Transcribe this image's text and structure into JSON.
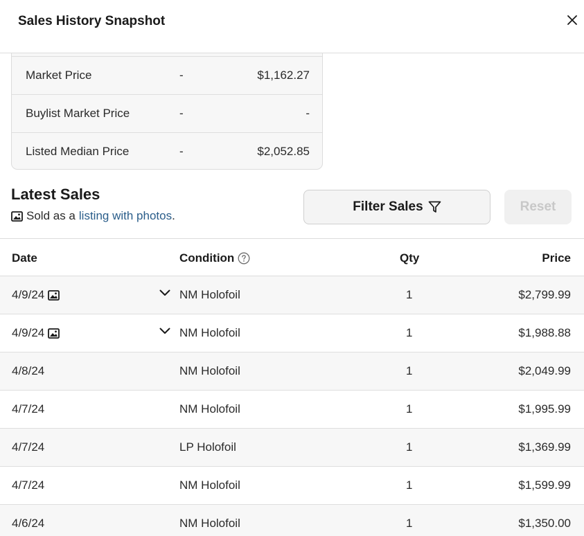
{
  "header": {
    "title": "Sales History Snapshot",
    "close_icon": "close-icon"
  },
  "snapshot": {
    "rows": [
      {
        "label": "Market Price",
        "middle": "-",
        "value": "$1,162.27"
      },
      {
        "label": "Buylist Market Price",
        "middle": "-",
        "value": "-"
      },
      {
        "label": "Listed Median Price",
        "middle": "-",
        "value": "$2,052.85"
      }
    ]
  },
  "latest_sales": {
    "title": "Latest Sales",
    "subtitle_prefix": "Sold as a",
    "subtitle_link": "listing with photos",
    "subtitle_suffix": ".",
    "filter_label": "Filter Sales",
    "reset_label": "Reset"
  },
  "table": {
    "columns": {
      "date": "Date",
      "condition": "Condition",
      "qty": "Qty",
      "price": "Price"
    },
    "rows": [
      {
        "date": "4/9/24",
        "has_photo": true,
        "expandable": true,
        "condition": "NM Holofoil",
        "qty": "1",
        "price": "$2,799.99"
      },
      {
        "date": "4/9/24",
        "has_photo": true,
        "expandable": true,
        "condition": "NM Holofoil",
        "qty": "1",
        "price": "$1,988.88"
      },
      {
        "date": "4/8/24",
        "has_photo": false,
        "expandable": false,
        "condition": "NM Holofoil",
        "qty": "1",
        "price": "$2,049.99"
      },
      {
        "date": "4/7/24",
        "has_photo": false,
        "expandable": false,
        "condition": "NM Holofoil",
        "qty": "1",
        "price": "$1,995.99"
      },
      {
        "date": "4/7/24",
        "has_photo": false,
        "expandable": false,
        "condition": "LP Holofoil",
        "qty": "1",
        "price": "$1,369.99"
      },
      {
        "date": "4/7/24",
        "has_photo": false,
        "expandable": false,
        "condition": "NM Holofoil",
        "qty": "1",
        "price": "$1,599.99"
      },
      {
        "date": "4/6/24",
        "has_photo": false,
        "expandable": false,
        "condition": "NM Holofoil",
        "qty": "1",
        "price": "$1,350.00"
      }
    ]
  },
  "colors": {
    "link": "#2a5d8a",
    "reset_disabled": "#c8c8c8",
    "row_alt": "#f7f7f7"
  }
}
